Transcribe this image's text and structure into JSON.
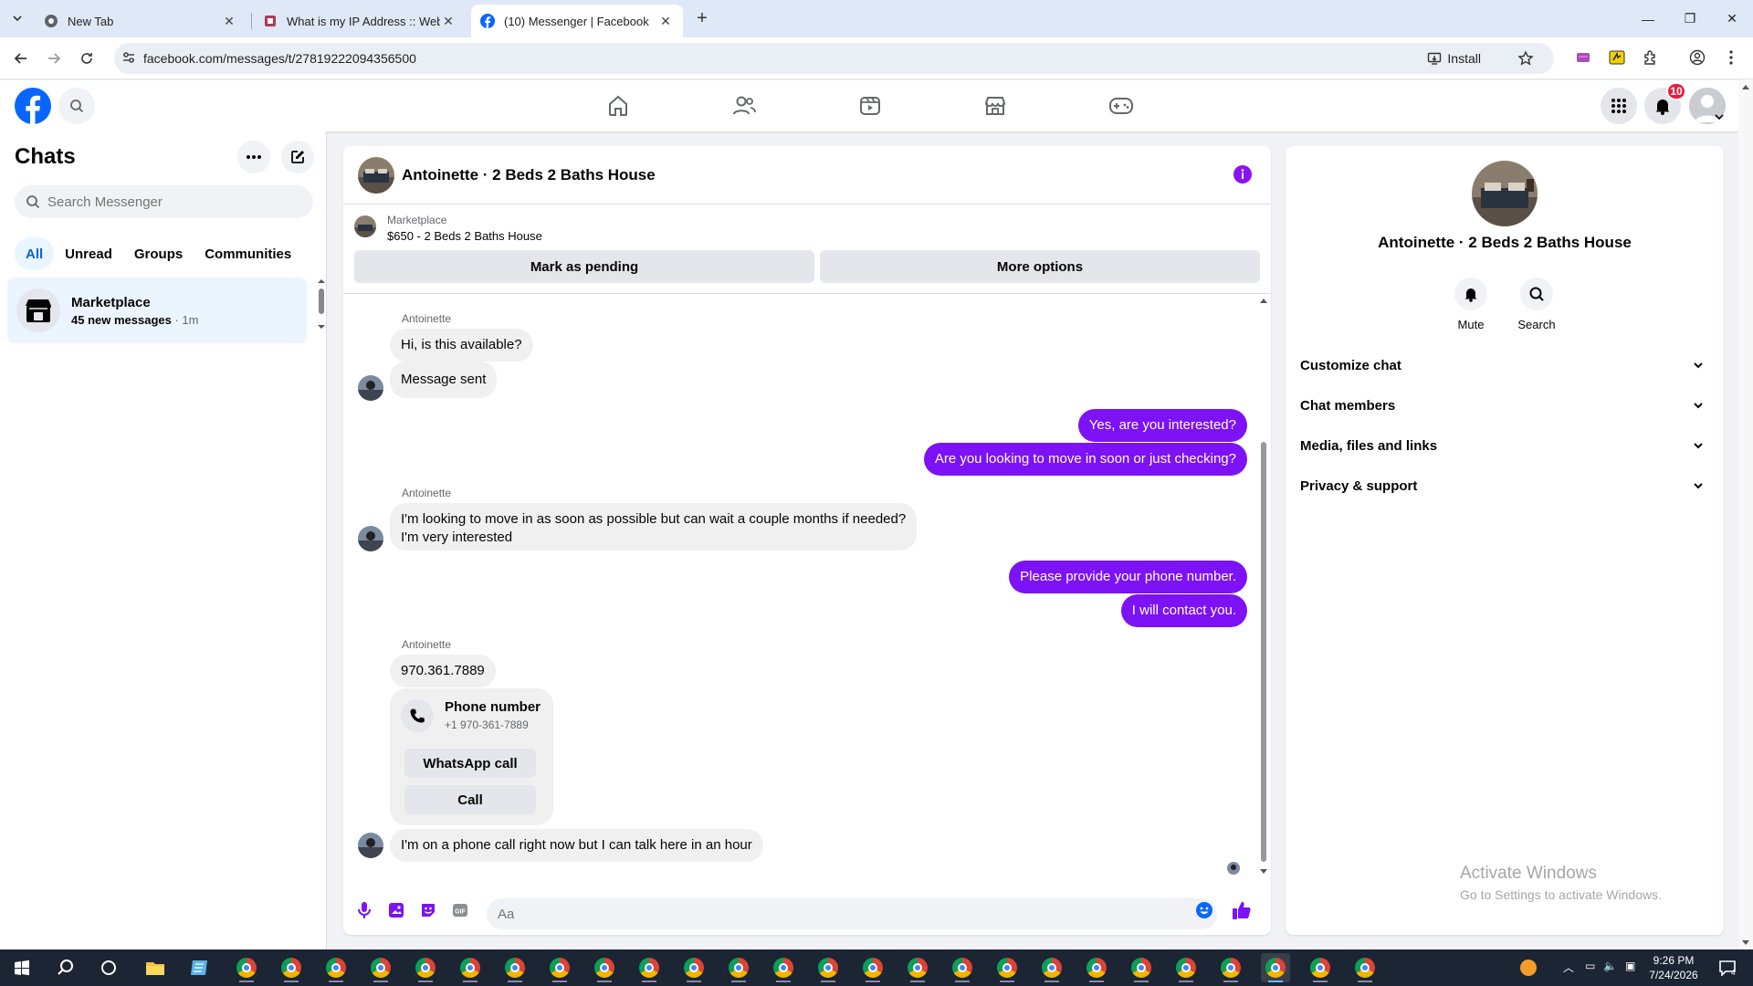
{
  "browser": {
    "tabs": [
      {
        "title": "New Tab"
      },
      {
        "title": "What is my IP Address :: WebBr"
      },
      {
        "title": "(10) Messenger | Facebook"
      }
    ],
    "url": "facebook.com/messages/t/27819222094356500",
    "install_label": "Install"
  },
  "fb": {
    "notifications_count": "10"
  },
  "chats": {
    "title": "Chats",
    "search_placeholder": "Search Messenger",
    "filters": [
      "All",
      "Unread",
      "Groups",
      "Communities"
    ],
    "items": [
      {
        "name": "Marketplace",
        "preview": "45 new messages",
        "time": " · 1m"
      }
    ]
  },
  "conversation": {
    "title": "Antoinette · 2 Beds 2 Baths House",
    "marketplace_label": "Marketplace",
    "listing": "$650 - 2 Beds 2 Baths House",
    "mark_pending": "Mark as pending",
    "more_options": "More options",
    "sender_name": "Antoinette",
    "messages": [
      "Hi, is this available?",
      "Message sent",
      "Yes, are you interested?",
      "Are you looking to move in soon or just checking?",
      "I'm looking to move in as soon as possible but can wait a couple months if needed?",
      "I'm very interested",
      "Please provide your phone number.",
      "I will contact you.",
      "970.361.7889",
      "I'm on a phone call right now but I can talk here in an hour"
    ],
    "phone_card": {
      "title": "Phone number",
      "number": "+1 970-361-7889",
      "whatsapp": "WhatsApp call",
      "call": "Call"
    },
    "composer_placeholder": "Aa"
  },
  "details": {
    "name": "Antoinette · 2 Beds 2 Baths House",
    "mute": "Mute",
    "search": "Search",
    "sections": [
      "Customize chat",
      "Chat members",
      "Media, files and links",
      "Privacy & support"
    ]
  },
  "watermark": {
    "line1": "Activate Windows",
    "line2": "Go to Settings to activate Windows."
  },
  "taskbar": {
    "time": "9:26 PM",
    "date": "7/24/2026"
  },
  "colors": {
    "outgoing_bubble": "#7c12f5",
    "fb_blue": "#0866ff"
  }
}
